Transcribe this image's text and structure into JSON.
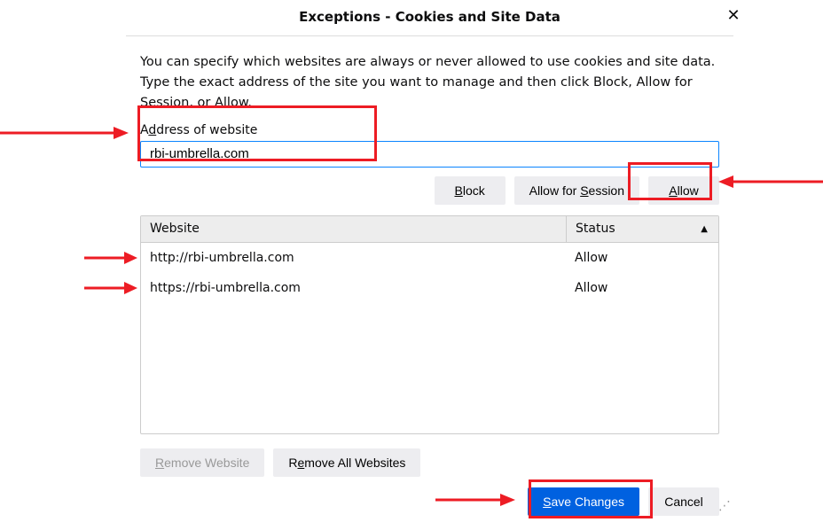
{
  "dialog": {
    "title": "Exceptions - Cookies and Site Data",
    "description": "You can specify which websites are always or never allowed to use cookies and site data. Type the exact address of the site you want to manage and then click Block, Allow for Session, or Allow.",
    "address_label_pre": "A",
    "address_label_u": "d",
    "address_label_post": "dress of website",
    "address_value": "rbi-umbrella.com",
    "buttons": {
      "block_pre": "",
      "block_u": "B",
      "block_post": "lock",
      "session_pre": "Allow for ",
      "session_u": "S",
      "session_post": "ession",
      "allow_pre": "",
      "allow_u": "A",
      "allow_post": "llow"
    },
    "table": {
      "header_website": "Website",
      "header_status": "Status",
      "rows": [
        {
          "website": "http://rbi-umbrella.com",
          "status": "Allow"
        },
        {
          "website": "https://rbi-umbrella.com",
          "status": "Allow"
        }
      ]
    },
    "remove_website_pre": "",
    "remove_website_u": "R",
    "remove_website_post": "emove Website",
    "remove_all_pre": "R",
    "remove_all_u": "e",
    "remove_all_post": "move All Websites",
    "save_pre": "",
    "save_u": "S",
    "save_post": "ave Changes",
    "cancel": "Cancel"
  }
}
